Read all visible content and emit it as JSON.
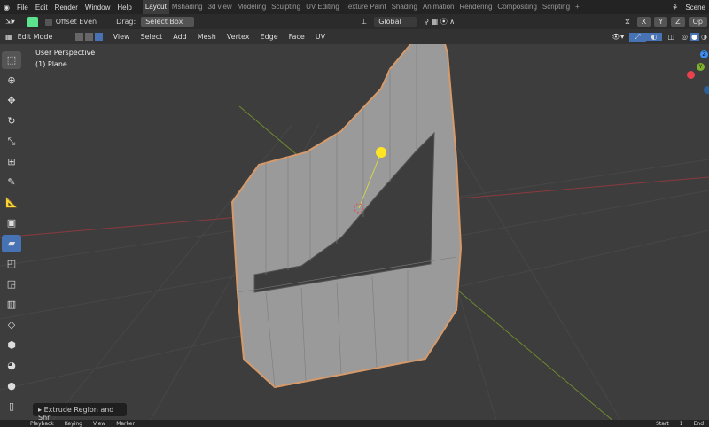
{
  "menu": [
    "File",
    "Edit",
    "Render",
    "Window",
    "Help"
  ],
  "workspaces": [
    "Layout",
    "Mshading",
    "3d view",
    "Modeling",
    "Sculpting",
    "UV Editing",
    "Texture Paint",
    "Shading",
    "Animation",
    "Rendering",
    "Compositing",
    "Scripting"
  ],
  "active_workspace": "Layout",
  "add_workspace": "+",
  "scene": "Scene",
  "toolbar": {
    "offset_even": "Offset Even",
    "drag_label": "Drag:",
    "drag_value": "Select Box",
    "orientation": "Global",
    "axes": [
      "X",
      "Y",
      "Z"
    ],
    "options": "Op"
  },
  "header": {
    "mode": "Edit Mode",
    "menus": [
      "View",
      "Select",
      "Add",
      "Mesh",
      "Vertex",
      "Edge",
      "Face",
      "UV"
    ]
  },
  "viewport": {
    "perspective": "User Perspective",
    "object": "(1) Plane"
  },
  "gizmo": {
    "z": "Z",
    "y": "Y"
  },
  "operator_panel": "Extrude Region and Shri",
  "timeline": {
    "menus": [
      "Playback",
      "Keying",
      "View",
      "Marker"
    ],
    "start_label": "Start",
    "start": "1",
    "end_label": "End"
  },
  "colors": {
    "accent": "#4772b3",
    "x_axis": "#e8424f",
    "y_axis": "#7fb12e",
    "z_axis": "#3d8ef0",
    "mesh_edge": "#d69a6a"
  }
}
